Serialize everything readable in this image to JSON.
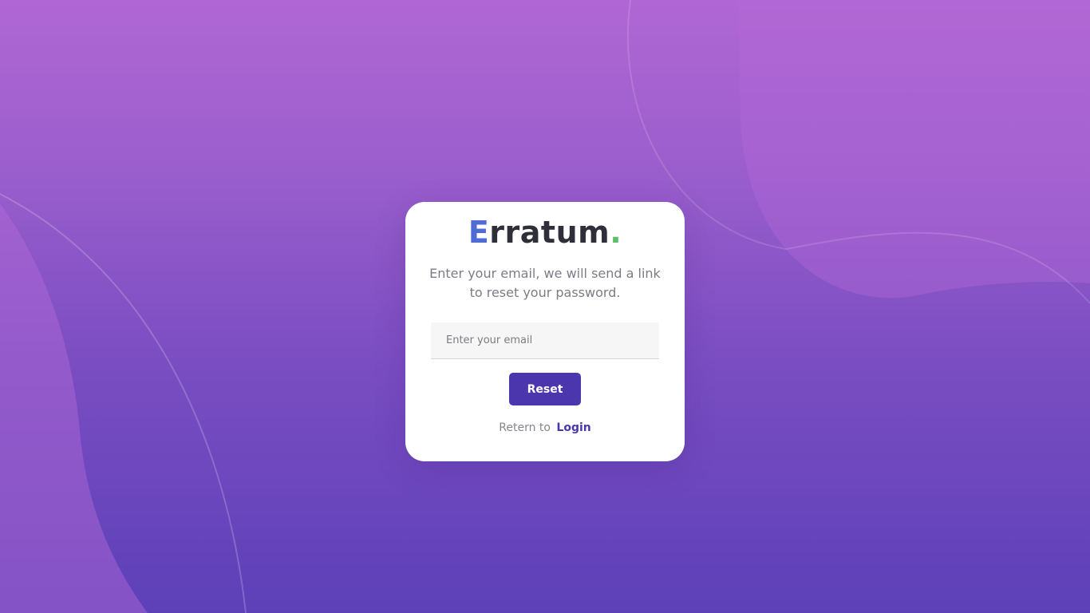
{
  "brand": {
    "first_letter": "E",
    "rest": "rratum",
    "dot": "."
  },
  "reset_form": {
    "instructions": "Enter your email, we will send a link to reset your password.",
    "email_placeholder": "Enter your email",
    "email_value": "",
    "submit_label": "Reset"
  },
  "footer": {
    "return_text": "Retern to",
    "login_label": "Login"
  },
  "colors": {
    "background_top": "#b067d4",
    "background_bottom": "#5d40b8",
    "accent": "#4b36ad",
    "logo_e": "#4f6bd6",
    "logo_dot": "#5cc06a"
  }
}
